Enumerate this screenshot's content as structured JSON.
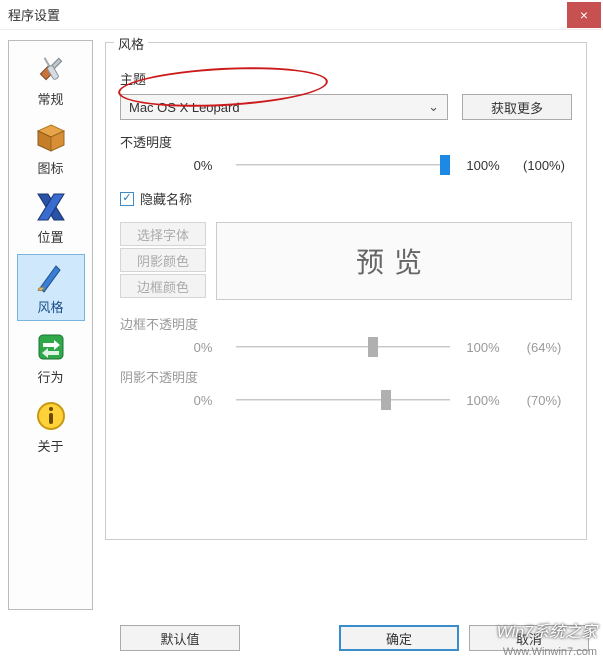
{
  "window": {
    "title": "程序设置",
    "close": "×"
  },
  "sidebar": {
    "items": [
      {
        "label": "常规"
      },
      {
        "label": "图标"
      },
      {
        "label": "位置"
      },
      {
        "label": "风格"
      },
      {
        "label": "行为"
      },
      {
        "label": "关于"
      }
    ]
  },
  "main": {
    "group_title": "风格",
    "theme": {
      "label": "主题",
      "selected": "Mac OS X Leopard",
      "more_btn": "获取更多"
    },
    "opacity": {
      "label": "不透明度",
      "min": "0%",
      "max": "100%",
      "value_display": "(100%)",
      "value_pct": 100
    },
    "hide_name": {
      "label": "隐藏名称",
      "checked": true
    },
    "name_settings": {
      "font_btn": "选择字体",
      "shadow_color_btn": "阴影颜色",
      "border_color_btn": "边框颜色",
      "preview_label": "预览"
    },
    "border_opacity": {
      "label": "边框不透明度",
      "min": "0%",
      "max": "100%",
      "value_display": "(64%)",
      "value_pct": 64
    },
    "shadow_opacity": {
      "label": "阴影不透明度",
      "min": "0%",
      "max": "100%",
      "value_display": "(70%)",
      "value_pct": 70
    }
  },
  "footer": {
    "defaults": "默认值",
    "ok": "确定",
    "cancel": "取消"
  },
  "watermarks": {
    "w1": "Win7系统之家",
    "w2": "Www.Winwin7.com"
  }
}
